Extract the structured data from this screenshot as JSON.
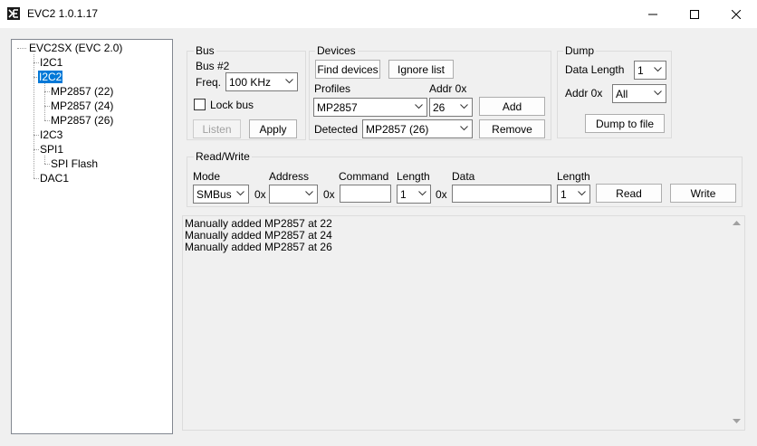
{
  "window": {
    "title": "EVC2 1.0.1.17",
    "icon": "evc2-app-icon",
    "controls": [
      "minimize-icon",
      "maximize-icon",
      "close-icon"
    ]
  },
  "tree": {
    "root": "EVC2SX (EVC 2.0)",
    "i2c1": "I2C1",
    "i2c2": "I2C2",
    "mp22": "MP2857 (22)",
    "mp24": "MP2857 (24)",
    "mp26": "MP2857 (26)",
    "i2c3": "I2C3",
    "spi1": "SPI1",
    "spiflash": "SPI Flash",
    "dac1": "DAC1",
    "selected": "I2C2"
  },
  "bus": {
    "title": "Bus",
    "bus_name": "Bus #2",
    "freq_label": "Freq.",
    "freq_value": "100 KHz",
    "lock_label": "Lock bus",
    "lock_checked": false,
    "listen_label": "Listen",
    "apply_label": "Apply"
  },
  "devices": {
    "title": "Devices",
    "find_label": "Find devices",
    "ignore_label": "Ignore list",
    "profiles_label": "Profiles",
    "addr_label": "Addr 0x",
    "profile_value": "MP2857",
    "addr_value": "26",
    "add_label": "Add",
    "detected_label": "Detected",
    "detected_value": "MP2857 (26)",
    "remove_label": "Remove"
  },
  "dump": {
    "title": "Dump",
    "data_length_label": "Data Length",
    "data_length_value": "1",
    "addr_label": "Addr 0x",
    "addr_value": "All",
    "dump_label": "Dump to file"
  },
  "readwrite": {
    "title": "Read/Write",
    "mode_label": "Mode",
    "mode_value": "SMBus",
    "hex_prefix": "0x",
    "address_label": "Address",
    "address_value": "",
    "command_label": "Command",
    "command_value": "",
    "length_label": "Length",
    "length_value": "1",
    "data_label": "Data",
    "data_value": "",
    "length2_label": "Length",
    "length2_value": "1",
    "read_label": "Read",
    "write_label": "Write"
  },
  "log": {
    "lines": [
      "Manually added MP2857 at 22",
      "Manually added MP2857 at 24",
      "Manually added MP2857 at 26"
    ]
  }
}
